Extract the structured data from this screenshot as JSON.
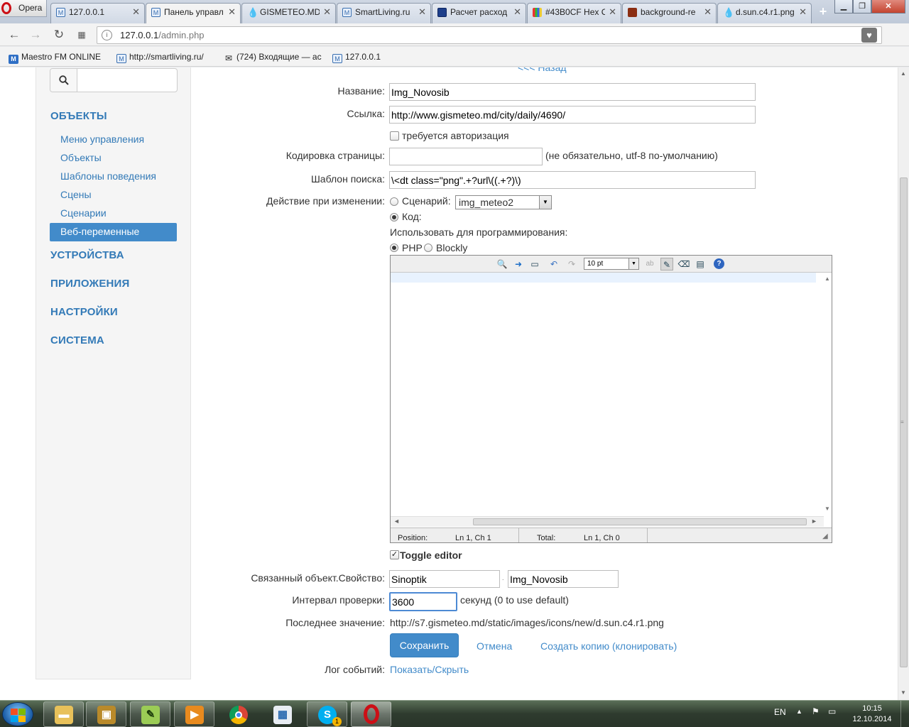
{
  "browser": {
    "menu_label": "Opera",
    "tabs": [
      {
        "title": "127.0.0.1",
        "icon": "majordomo-icon"
      },
      {
        "title": "Панель управл",
        "icon": "majordomo-icon",
        "active": true
      },
      {
        "title": "GISMETEO.MD",
        "icon": "drop-icon"
      },
      {
        "title": "SmartLiving.ru",
        "icon": "majordomo-icon"
      },
      {
        "title": "Расчет расход",
        "icon": "page-icon"
      },
      {
        "title": "#43B0CF Hex C",
        "icon": "grid-icon"
      },
      {
        "title": "background-re",
        "icon": "brick-icon"
      },
      {
        "title": "d.sun.c4.r1.png",
        "icon": "drop-icon"
      }
    ],
    "url_host": "127.0.0.1",
    "url_path": "/admin.php",
    "bookmarks": [
      {
        "label": "Maestro FM ONLINE",
        "icon": "maestro-icon"
      },
      {
        "label": "http://smartliving.ru/",
        "icon": "majordomo-icon"
      },
      {
        "label": "(724) Входящие — ас",
        "icon": "mail-icon"
      },
      {
        "label": "127.0.0.1",
        "icon": "majordomo-icon"
      }
    ]
  },
  "sidebar": {
    "search_placeholder": "",
    "sections": {
      "objects": "ОБЪЕКТЫ",
      "devices": "УСТРОЙСТВА",
      "apps": "ПРИЛОЖЕНИЯ",
      "settings": "НАСТРОЙКИ",
      "system": "СИСТЕМА"
    },
    "items": [
      "Меню управления",
      "Объекты",
      "Шаблоны поведения",
      "Сцены",
      "Сценарии",
      "Веб-переменные"
    ],
    "active_item": "Веб-переменные"
  },
  "form": {
    "back_link": "<<< Назад",
    "name_label": "Название:",
    "name_value": "Img_Novosib",
    "url_label": "Ссылка:",
    "url_value": "http://www.gismeteo.md/city/daily/4690/",
    "auth_label": "требуется авторизация",
    "encoding_label": "Кодировка страницы:",
    "encoding_value": "",
    "encoding_hint": "(не обязательно, utf-8 по-умолчанию)",
    "pattern_label": "Шаблон поиска:",
    "pattern_value": "\\<dt class=\"png\".+?url\\((.+?)\\)",
    "action_label": "Действие при изменении:",
    "script_label": "Сценарий:",
    "script_select": "img_meteo2",
    "code_label": "Код:",
    "use_for_label": "Использовать для программирования:",
    "php_label": "PHP",
    "blockly_label": "Blockly",
    "toggle_label": "Toggle editor",
    "linked_label": "Связанный объект.Свойство:",
    "linked_object": "Sinoptik",
    "linked_sep": ".",
    "linked_property": "Img_Novosib",
    "interval_label": "Интервал проверки:",
    "interval_value": "3600",
    "interval_hint": "секунд (0 to use default)",
    "last_label": "Последнее значение:",
    "last_value": "http://s7.gismeteo.md/static/images/icons/new/d.sun.c4.r1.png",
    "save_label": "Сохранить",
    "cancel_label": "Отмена",
    "clone_label": "Создать копию (клонировать)",
    "log_label": "Лог событий:",
    "log_link": "Показать/Скрыть"
  },
  "editor": {
    "font_size": "10 pt",
    "position_label": "Position:",
    "position_value": "Ln 1, Ch 1",
    "total_label": "Total:",
    "total_value": "Ln 1, Ch 0"
  },
  "taskbar": {
    "lang": "EN",
    "time": "10:15",
    "date": "12.10.2014",
    "skype_badge": "1"
  },
  "colors": {
    "link": "#337ab7",
    "primary": "#428bca",
    "active_nav": "#428bca"
  }
}
